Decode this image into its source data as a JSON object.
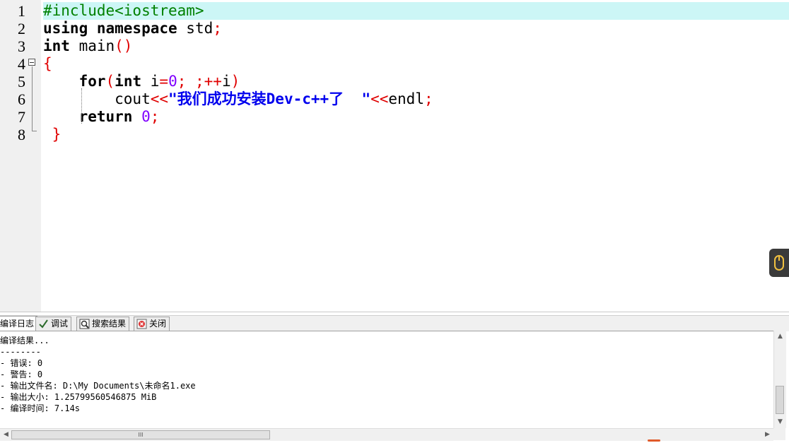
{
  "editor": {
    "line_numbers": [
      "1",
      "2",
      "3",
      "4",
      "5",
      "6",
      "7",
      "8"
    ],
    "lines": [
      [
        {
          "t": "#include<iostream>",
          "c": "pre"
        }
      ],
      [
        {
          "t": "using namespace ",
          "c": "kw"
        },
        {
          "t": "std",
          "c": "std"
        },
        {
          "t": ";",
          "c": "sym"
        }
      ],
      [
        {
          "t": "int",
          "c": "kw"
        },
        {
          "t": " main",
          "c": "std"
        },
        {
          "t": "()",
          "c": "sym"
        }
      ],
      [
        {
          "t": "{",
          "c": "sym"
        }
      ],
      [
        {
          "t": "    ",
          "c": "std"
        },
        {
          "t": "for",
          "c": "kw"
        },
        {
          "t": "(",
          "c": "sym"
        },
        {
          "t": "int",
          "c": "kw"
        },
        {
          "t": " i",
          "c": "std"
        },
        {
          "t": "=",
          "c": "sym"
        },
        {
          "t": "0",
          "c": "num"
        },
        {
          "t": "; ;++",
          "c": "sym"
        },
        {
          "t": "i",
          "c": "std"
        },
        {
          "t": ")",
          "c": "sym"
        }
      ],
      [
        {
          "t": "        cout",
          "c": "std"
        },
        {
          "t": "<<",
          "c": "sym"
        },
        {
          "t": "\"我们成功安装Dev-c++了  \"",
          "c": "str"
        },
        {
          "t": "<<",
          "c": "sym"
        },
        {
          "t": "endl",
          "c": "std"
        },
        {
          "t": ";",
          "c": "sym"
        }
      ],
      [
        {
          "t": "    ",
          "c": "std"
        },
        {
          "t": "return",
          "c": "kw"
        },
        {
          "t": " ",
          "c": "std"
        },
        {
          "t": "0",
          "c": "num"
        },
        {
          "t": ";",
          "c": "sym"
        }
      ],
      [
        {
          "t": " }",
          "c": "sym"
        }
      ]
    ]
  },
  "tabs": [
    {
      "label": "编译日志",
      "icon": "compile-log-icon"
    },
    {
      "label": "调试",
      "icon": "checkmark-icon"
    },
    {
      "label": "搜索结果",
      "icon": "search-icon"
    },
    {
      "label": "关闭",
      "icon": "close-icon"
    }
  ],
  "log": {
    "lines": [
      "编译结果...",
      "--------",
      "- 错误: 0",
      "- 警告: 0",
      "- 输出文件名: D:\\My Documents\\未命名1.exe",
      "- 输出大小: 1.25799560546875 MiB",
      "- 编译时间: 7.14s"
    ]
  },
  "scrollbar": {
    "h_thumb_label": "III"
  },
  "colors": {
    "current_line": "#ccf6f6",
    "preprocessor": "#008000",
    "symbol": "#e00000",
    "number": "#8000ff",
    "string": "#0000ee",
    "gutter": "#f0f0f0"
  }
}
